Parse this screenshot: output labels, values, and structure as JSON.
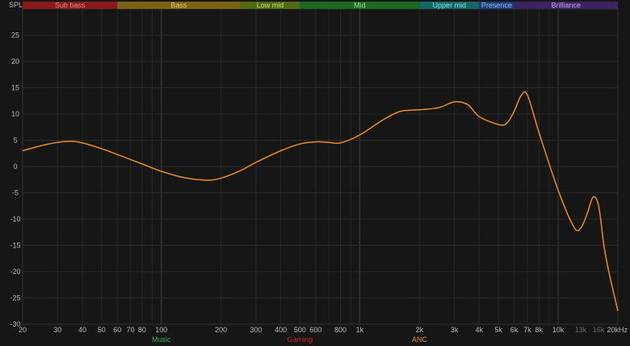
{
  "chart_data": {
    "type": "line",
    "ylabel": "SPL",
    "x_scale": "log",
    "xlim": [
      20,
      20000
    ],
    "ylim": [
      -30,
      30
    ],
    "y_ticks": [
      25,
      20,
      15,
      10,
      5,
      0,
      -5,
      -10,
      -15,
      -20,
      -25,
      -30
    ],
    "x_ticks": [
      {
        "v": 20,
        "label": "20"
      },
      {
        "v": 30,
        "label": "30"
      },
      {
        "v": 40,
        "label": "40"
      },
      {
        "v": 50,
        "label": "50"
      },
      {
        "v": 60,
        "label": "60"
      },
      {
        "v": 70,
        "label": "70"
      },
      {
        "v": 80,
        "label": "80"
      },
      {
        "v": 100,
        "label": "100"
      },
      {
        "v": 200,
        "label": "200"
      },
      {
        "v": 300,
        "label": "300"
      },
      {
        "v": 400,
        "label": "400"
      },
      {
        "v": 500,
        "label": "500"
      },
      {
        "v": 600,
        "label": "600"
      },
      {
        "v": 800,
        "label": "800"
      },
      {
        "v": 1000,
        "label": "1k"
      },
      {
        "v": 2000,
        "label": "2k"
      },
      {
        "v": 3000,
        "label": "3k"
      },
      {
        "v": 4000,
        "label": "4k"
      },
      {
        "v": 5000,
        "label": "5k"
      },
      {
        "v": 6000,
        "label": "6k"
      },
      {
        "v": 7000,
        "label": "7k"
      },
      {
        "v": 8000,
        "label": "8k"
      },
      {
        "v": 10000,
        "label": "10k"
      },
      {
        "v": 13000,
        "label": "13k",
        "dim": true
      },
      {
        "v": 16000,
        "label": "16k",
        "dim": true
      },
      {
        "v": 20000,
        "label": "20kHz"
      }
    ],
    "bands": [
      {
        "label": "Sub bass",
        "from": 20,
        "to": 60,
        "color": "#8a1a1a",
        "text": "#e08a8a"
      },
      {
        "label": "Bass",
        "from": 60,
        "to": 250,
        "color": "#7a6413",
        "text": "#e7cf6a"
      },
      {
        "label": "Low mid",
        "from": 250,
        "to": 500,
        "color": "#4f6a12",
        "text": "#c3e27a"
      },
      {
        "label": "Mid",
        "from": 500,
        "to": 2000,
        "color": "#1a6a22",
        "text": "#8ee39a"
      },
      {
        "label": "Upper mid",
        "from": 2000,
        "to": 4000,
        "color": "#166667",
        "text": "#8de3e3"
      },
      {
        "label": "Presence",
        "from": 4000,
        "to": 6000,
        "color": "#1b3e7a",
        "text": "#98b8f2"
      },
      {
        "label": "Brilliance",
        "from": 6000,
        "to": 20000,
        "color": "#3d2262",
        "text": "#c6a8ef"
      }
    ],
    "category_labels": [
      {
        "label": "Music",
        "v": 100,
        "color": "#2fb54a"
      },
      {
        "label": "Gaming",
        "v": 500,
        "color": "#c8281f"
      },
      {
        "label": "ANC",
        "v": 2000,
        "color": "#e5892a"
      }
    ],
    "series": [
      {
        "color": "#f08a25",
        "x": [
          20,
          25,
          30,
          35,
          40,
          50,
          60,
          80,
          100,
          130,
          170,
          200,
          250,
          300,
          400,
          500,
          600,
          700,
          800,
          1000,
          1300,
          1600,
          2000,
          2500,
          3000,
          3500,
          4000,
          5000,
          5500,
          6000,
          6500,
          7000,
          8000,
          10000,
          12000,
          13000,
          14000,
          15000,
          16000,
          17000,
          18000,
          20000
        ],
        "y": [
          3,
          4,
          4.6,
          4.8,
          4.5,
          3.4,
          2.3,
          0.5,
          -0.9,
          -2.1,
          -2.6,
          -2.2,
          -0.8,
          0.8,
          3,
          4.3,
          4.7,
          4.6,
          4.5,
          6,
          8.8,
          10.5,
          10.8,
          11.2,
          12.3,
          11.8,
          9.5,
          8,
          8.2,
          10.5,
          13.5,
          13.6,
          6.5,
          -4.5,
          -11.5,
          -11.7,
          -9,
          -5.8,
          -7.5,
          -15,
          -20,
          -27.5
        ]
      }
    ]
  }
}
